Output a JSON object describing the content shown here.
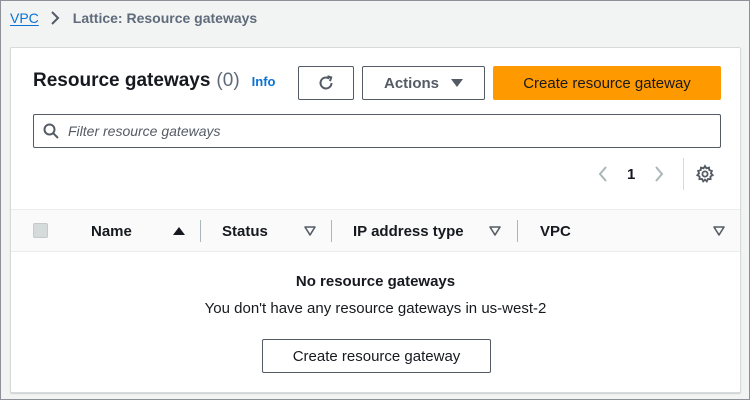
{
  "breadcrumb": {
    "root": "VPC",
    "current": "Lattice: Resource gateways"
  },
  "header": {
    "title": "Resource gateways",
    "count": "(0)",
    "info": "Info"
  },
  "toolbar": {
    "actions_label": "Actions",
    "create_label": "Create resource gateway"
  },
  "search": {
    "placeholder": "Filter resource gateways",
    "value": ""
  },
  "pagination": {
    "current_page": "1"
  },
  "table": {
    "columns": [
      "Name",
      "Status",
      "IP address type",
      "VPC"
    ]
  },
  "empty_state": {
    "title": "No resource gateways",
    "description": "You don't have any resource gateways in us-west-2",
    "button_label": "Create resource gateway"
  },
  "colors": {
    "accent": "#0972d3",
    "primary_button": "#ff9900",
    "text": "#16191f",
    "muted_text": "#5f6b7a"
  },
  "icons": {
    "breadcrumb_separator": "chevron-right-icon",
    "refresh": "refresh-icon",
    "actions_caret": "caret-down-icon",
    "search": "search-icon",
    "prev": "chevron-left-icon",
    "next": "chevron-right-icon",
    "settings": "gear-icon",
    "sort_asc": "caret-up-icon",
    "sort_desc": "caret-down-icon"
  }
}
